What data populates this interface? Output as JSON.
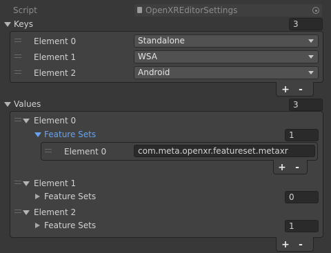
{
  "script_row": {
    "label": "Script",
    "value": "OpenXREditorSettings"
  },
  "keys": {
    "label": "Keys",
    "size": "3",
    "elements": [
      {
        "label": "Element 0",
        "value": "Standalone"
      },
      {
        "label": "Element 1",
        "value": "WSA"
      },
      {
        "label": "Element 2",
        "value": "Android"
      }
    ]
  },
  "values": {
    "label": "Values",
    "size": "3",
    "elements": [
      {
        "label": "Element 0",
        "feature_sets_label": "Feature Sets",
        "feature_sets_size": "1",
        "sub_elements": [
          {
            "label": "Element 0",
            "value": "com.meta.openxr.featureset.metaxr"
          }
        ]
      },
      {
        "label": "Element 1",
        "feature_sets_label": "Feature Sets",
        "feature_sets_size": "0"
      },
      {
        "label": "Element 2",
        "feature_sets_label": "Feature Sets",
        "feature_sets_size": "1"
      }
    ]
  },
  "buttons": {
    "add": "+",
    "remove": "-"
  }
}
